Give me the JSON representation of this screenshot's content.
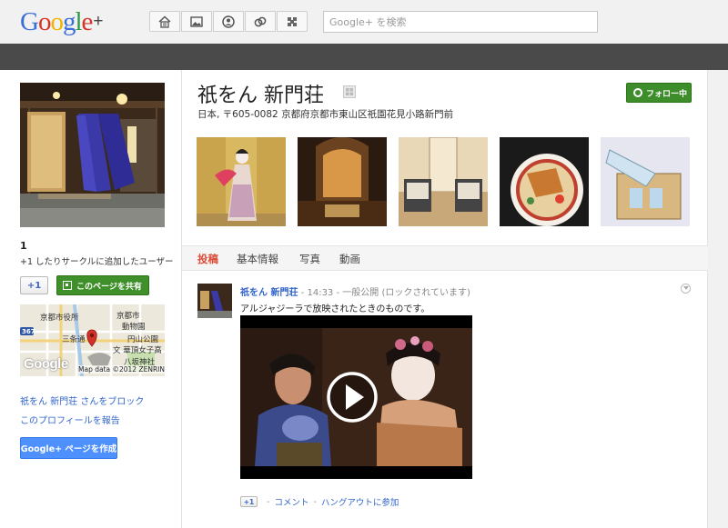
{
  "app": {
    "logo_text": "Google",
    "logo_plus": "+",
    "search_placeholder": "Google+ を検索"
  },
  "nav_icons": [
    "home-icon",
    "photos-icon",
    "profile-icon",
    "circles-icon",
    "games-icon"
  ],
  "sidebar": {
    "plus_count": "1",
    "plus_count_text": "+1 したりサークルに追加したユーザー",
    "plus_one_label": "+1",
    "share_label": "このページを共有",
    "map": {
      "labels": [
        "京都市役所",
        "京都市",
        "動物園",
        "三条通",
        "文 華頂女子高",
        "円山公園",
        "八坂神社"
      ],
      "route_badge": "367",
      "logo": "Google",
      "credit": "Map data ©2012 ZENRIN"
    },
    "block_link": "祇をん 新門荘 さんをブロック",
    "report_link": "このプロフィールを報告",
    "create_page_label": "Google+ ページを作成"
  },
  "header": {
    "title": "祇をん 新門荘",
    "address": "日本, 〒605-0082 京都府京都市東山区祇園花見小路新門前",
    "follow_label": "フォロー中"
  },
  "tabs": [
    {
      "label": "投稿",
      "active": true
    },
    {
      "label": "基本情報",
      "active": false
    },
    {
      "label": "写真",
      "active": false
    },
    {
      "label": "動画",
      "active": false
    }
  ],
  "post": {
    "author": "祇をん 新門荘",
    "time": "14:33",
    "visibility": "一般公開 (ロックされています)",
    "text": "アルジャジーラで放映されたときのものです。",
    "plus_one_label": "+1",
    "comment_label": "コメント",
    "hangout_label": "ハングアウトに参加"
  },
  "colors": {
    "accent_green": "#3d8e2b",
    "link_blue": "#3366cc",
    "active_tab_red": "#dd4b39",
    "create_button_blue": "#4d90fe"
  }
}
